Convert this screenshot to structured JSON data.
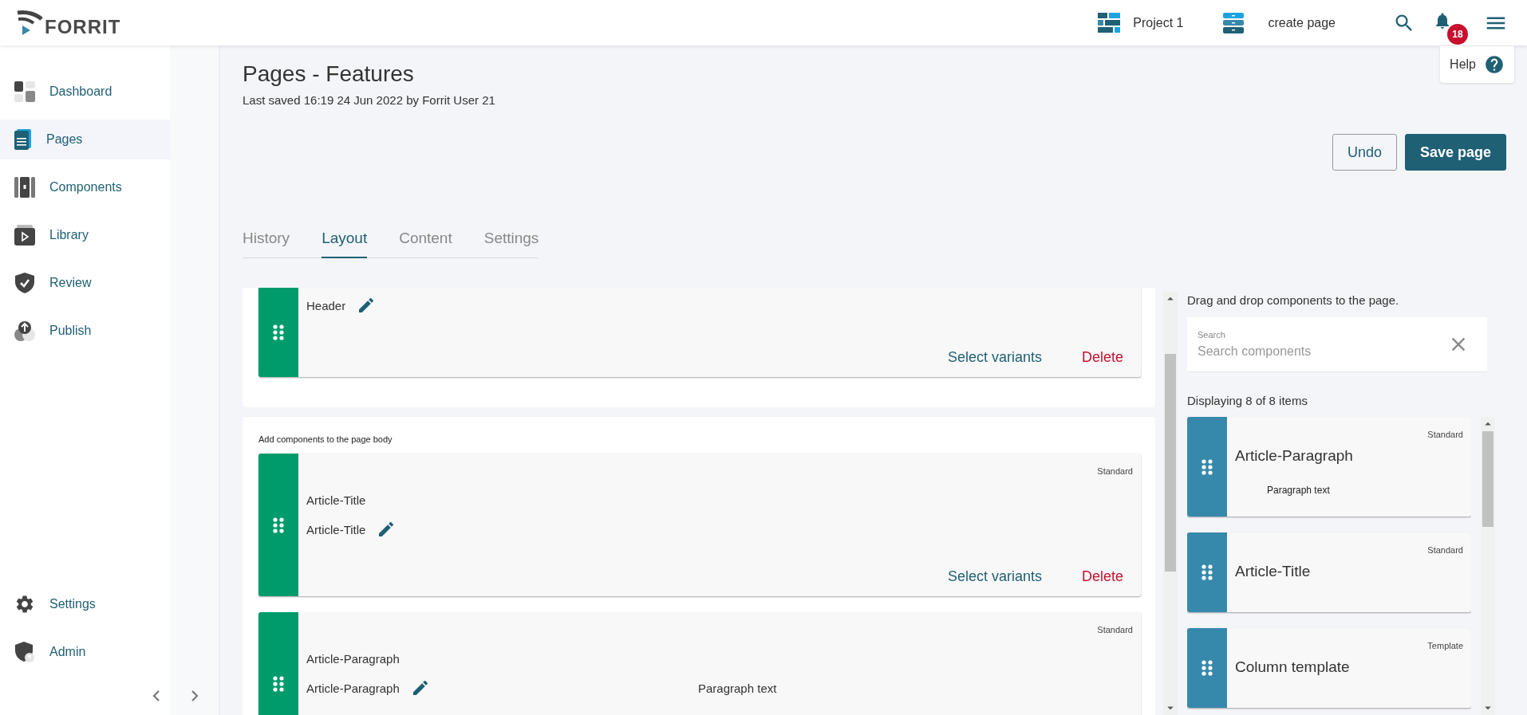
{
  "header": {
    "logo": "FORRIT",
    "project": "Project 1",
    "page": "create page",
    "notification_count": "18",
    "help": "Help"
  },
  "sidebar": {
    "items": [
      {
        "label": "Dashboard",
        "selected": false
      },
      {
        "label": "Pages",
        "selected": true
      },
      {
        "label": "Components",
        "selected": false
      },
      {
        "label": "Library",
        "selected": false
      },
      {
        "label": "Review",
        "selected": false
      },
      {
        "label": "Publish",
        "selected": false
      }
    ],
    "footer_items": [
      {
        "label": "Settings",
        "selected": false
      },
      {
        "label": "Admin",
        "selected": false
      }
    ]
  },
  "page": {
    "title": "Pages - Features",
    "subtitle": "Last saved 16:19 24 Jun 2022 by Forrit User 21"
  },
  "actions": [
    {
      "label": "Undo",
      "kind": "secondary"
    },
    {
      "label": "Save page",
      "kind": "primary"
    }
  ],
  "tabs": [
    {
      "label": "History",
      "selected": false
    },
    {
      "label": "Layout",
      "selected": true
    },
    {
      "label": "Content",
      "selected": false
    },
    {
      "label": "Settings",
      "selected": false
    }
  ],
  "layout": {
    "header_section": {
      "components": [
        {
          "name": "Header",
          "actions": [
            {
              "label": "Select variants",
              "kind": "link"
            },
            {
              "label": "Delete",
              "kind": "danger"
            }
          ]
        }
      ]
    },
    "body_section": {
      "hint": "Add components to the page body",
      "components": [
        {
          "type_label": "Standard",
          "title": "Article-Title",
          "name": "Article-Title",
          "actions": [
            {
              "label": "Select variants",
              "kind": "link"
            },
            {
              "label": "Delete",
              "kind": "danger"
            }
          ]
        },
        {
          "type_label": "Standard",
          "title": "Article-Paragraph",
          "name": "Article-Paragraph",
          "preview": "Paragraph text"
        }
      ]
    }
  },
  "library": {
    "instruction": "Drag and drop components to the page.",
    "search": {
      "label": "Search",
      "placeholder": "Search components"
    },
    "count": "Displaying 8 of 8 items",
    "items": [
      {
        "type_label": "Standard",
        "name": "Article-Paragraph",
        "preview": "Paragraph text"
      },
      {
        "type_label": "Standard",
        "name": "Article-Title"
      },
      {
        "type_label": "Template",
        "name": "Column template"
      }
    ]
  }
}
